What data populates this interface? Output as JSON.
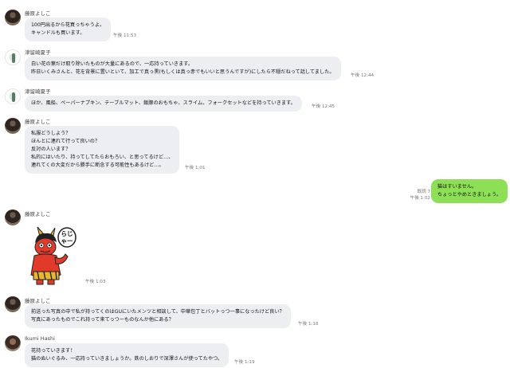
{
  "messages": [
    {
      "sender": "藤原よしこ",
      "lines": [
        "100円出るから花買っちゃうよ。",
        "キャンドルも買います。"
      ],
      "time": "午後 11:53"
    },
    {
      "sender": "津留崎夏子",
      "lines": [
        "白い花の葉だけ取り除いたものが大量にあるので、一応持っていきます。",
        "昨日いくみさんと、花を背景に置いといて、加工で真っ黒(もしくは真っ赤でもいいと思うんですが)にしたら不穏だねって話してました。"
      ],
      "time": "午後 12:44"
    },
    {
      "sender": "津留崎夏子",
      "lines": [
        "ほか、風船、ペーパーナプキン、テーブルマット、飯豚のおもちゃ、スライム、フォークセットなどを持っていきます。"
      ],
      "time": "午後 12:45"
    },
    {
      "sender": "藤原よしこ",
      "lines": [
        "私服どうしよう？",
        "ほんとに連れて行って良いの？",
        "反対の人います？",
        "私的にはいたり、持ってしてたらおもろい、と思ってるけど…、",
        "連れてくの大変だから勝手に断念する可能性もあるけど…。"
      ],
      "time": "午後 1:01"
    },
    {
      "sender": "me",
      "lines": [
        "猫はすいません。",
        "ちょっとやめときましょう。"
      ],
      "read": "既読 7",
      "time": "午後 1:02"
    },
    {
      "sender": "藤原よしこ",
      "sticker_text": "らじゃー",
      "time": "午後 1:03"
    },
    {
      "sender": "藤原よしこ",
      "lines": [
        "前送った写真の中で私が持ってくのはGUにいたメンツと相談して、中華包丁とバットっつ一事になったけど良い？",
        "写真にあったものでこれ持って来てっつーものなんか他にある？"
      ],
      "time": "午後 1:16"
    },
    {
      "sender": "Ikumi  Hashi",
      "lines": [
        "花持っていきます！",
        "猫のぬいぐるみ、一応持っていきましょうか。鉄のしおりで深澤さんが使ってたやつ。"
      ],
      "time": "午後 1:19"
    }
  ]
}
